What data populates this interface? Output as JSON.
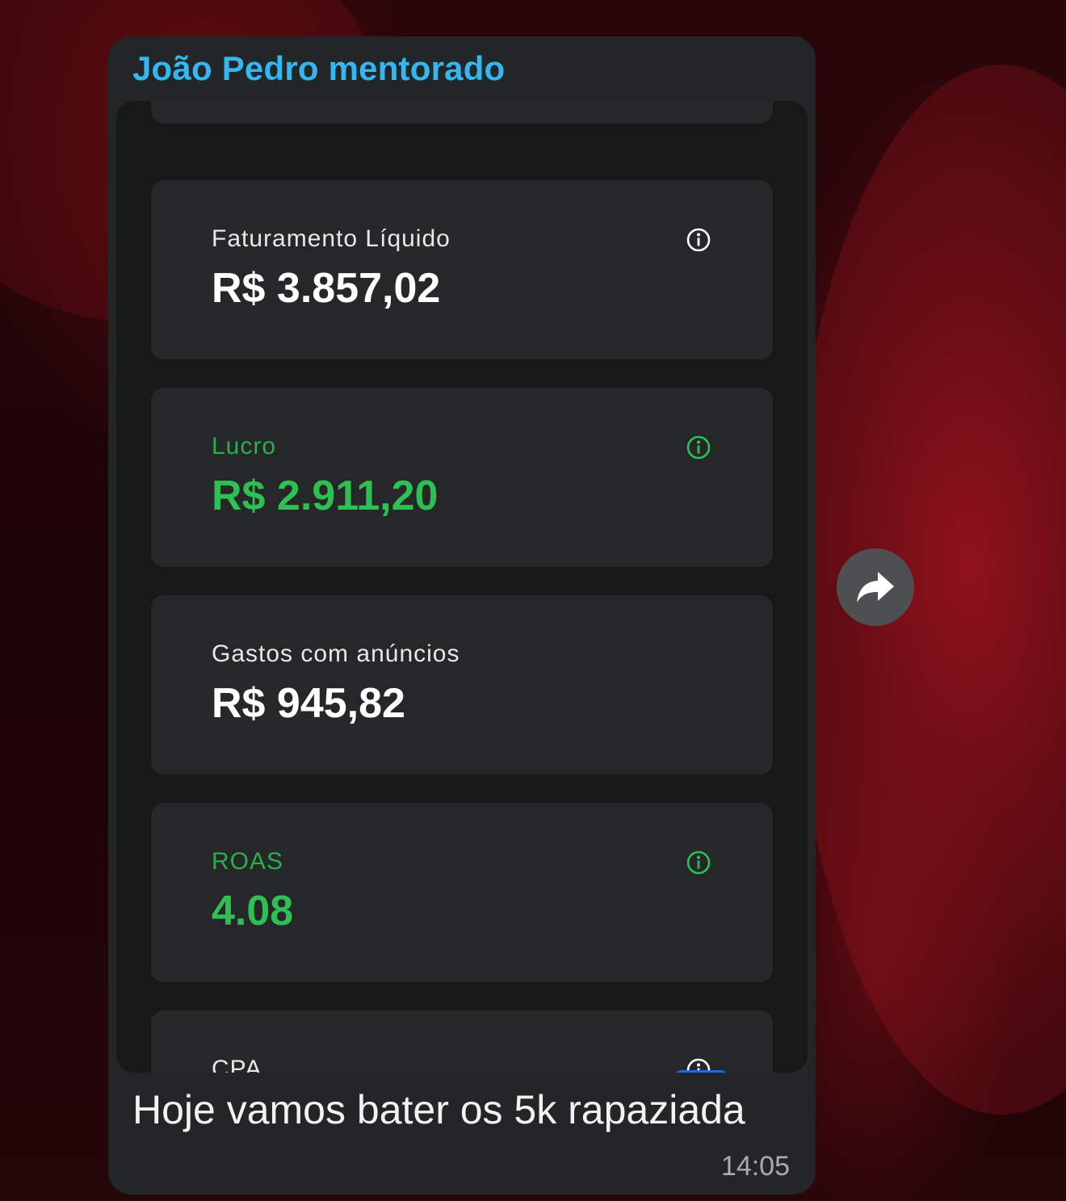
{
  "message": {
    "sender": "João Pedro mentorado",
    "caption": "Hoje vamos bater os 5k rapaziada",
    "time": "14:05"
  },
  "cards": [
    {
      "label": "Faturamento Líquido",
      "value": "R$ 3.857,02",
      "color": "#ffffff",
      "icon": "info-icon"
    },
    {
      "label": "Lucro",
      "value": "R$ 2.911,20",
      "color": "#2ec052",
      "icon": "info-icon"
    },
    {
      "label": "Gastos com anúncios",
      "value": "R$ 945,82",
      "color": "#ffffff",
      "icon": null
    },
    {
      "label": "ROAS",
      "value": "4.08",
      "color": "#2ec052",
      "icon": "info-icon"
    },
    {
      "label": "CPA",
      "value": "",
      "color": "#ffffff",
      "icon": "info-icon"
    }
  ],
  "forward_button": {
    "icon": "forward-arrow-icon"
  },
  "colors": {
    "sender": "#34b7f1",
    "bubble": "#232626",
    "card": "#252728",
    "positive": "#2ec052"
  }
}
